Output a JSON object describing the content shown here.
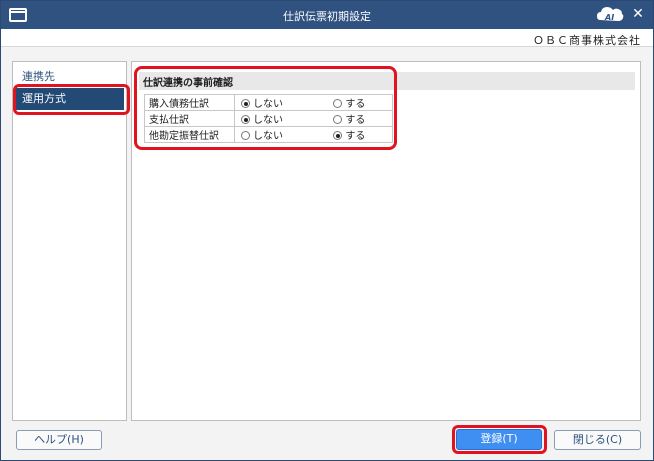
{
  "window": {
    "title": "仕訳伝票初期設定",
    "company": "ＯＢＣ商事株式会社",
    "logo_text": "AI"
  },
  "sidebar": {
    "items": [
      {
        "label": "連携先",
        "active": false
      },
      {
        "label": "運用方式",
        "active": true
      }
    ]
  },
  "section": {
    "heading": "仕訳連携の事前確認",
    "rows": [
      {
        "label": "購入債務仕訳",
        "option_no": "しない",
        "option_yes": "する",
        "selected": "しない"
      },
      {
        "label": "支払仕訳",
        "option_no": "しない",
        "option_yes": "する",
        "selected": "しない"
      },
      {
        "label": "他勘定振替仕訳",
        "option_no": "しない",
        "option_yes": "する",
        "selected": "する"
      }
    ]
  },
  "buttons": {
    "help": "ヘルプ(H)",
    "register": "登録(T)",
    "close": "閉じる(C)"
  },
  "colors": {
    "titlebar": "#2f5280",
    "active_item": "#234a75",
    "primary_button": "#3f8ef2",
    "highlight": "#e0141e"
  }
}
